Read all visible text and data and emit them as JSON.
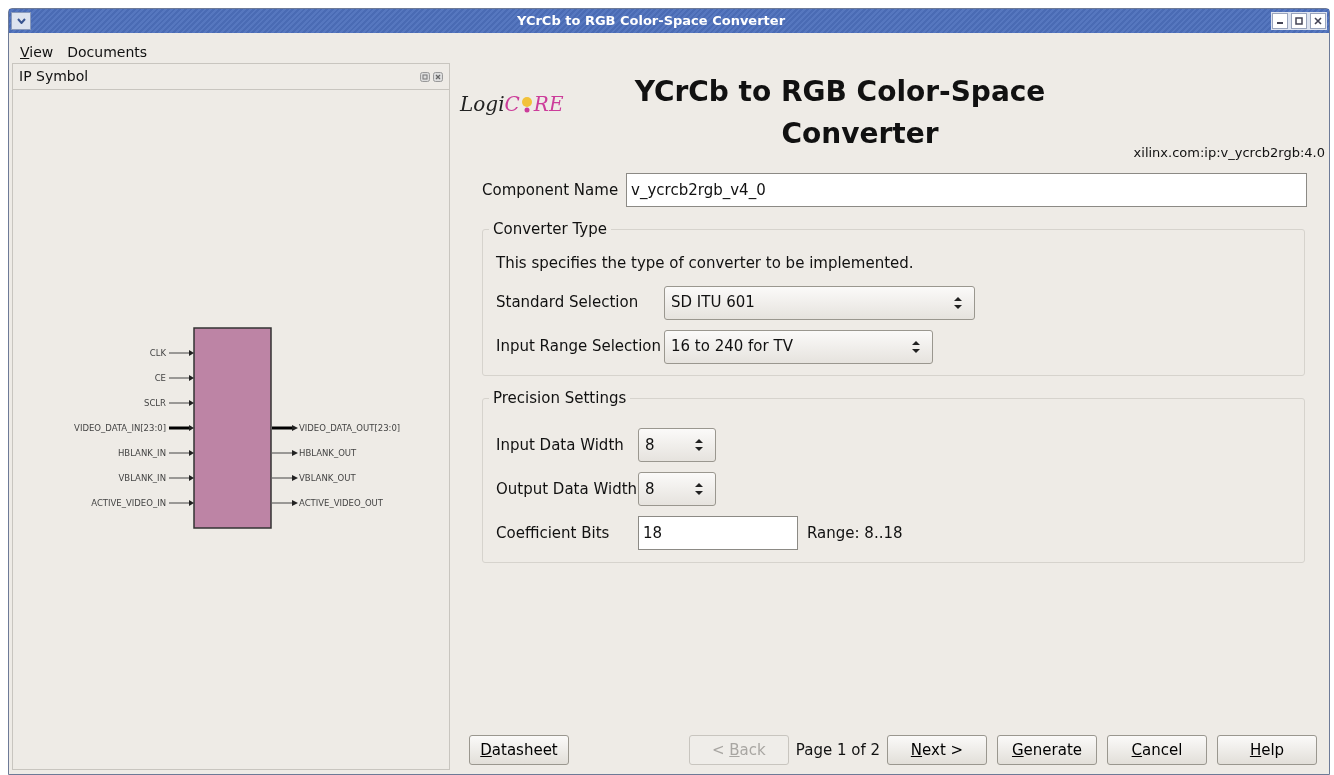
{
  "window": {
    "title": "YCrCb to RGB Color-Space Converter"
  },
  "menu": [
    {
      "key": "V",
      "after": "iew"
    },
    {
      "after": "Documents"
    }
  ],
  "ip_symbol": {
    "title": "IP Symbol",
    "inputs": [
      {
        "name": "CLK",
        "bus": false
      },
      {
        "name": "CE",
        "bus": false
      },
      {
        "name": "SCLR",
        "bus": false
      },
      {
        "name": "VIDEO_DATA_IN[23:0]",
        "bus": true
      },
      {
        "name": "HBLANK_IN",
        "bus": false
      },
      {
        "name": "VBLANK_IN",
        "bus": false
      },
      {
        "name": "ACTIVE_VIDEO_IN",
        "bus": false
      }
    ],
    "outputs": [
      {
        "name": "VIDEO_DATA_OUT[23:0]",
        "bus": true
      },
      {
        "name": "HBLANK_OUT",
        "bus": false
      },
      {
        "name": "VBLANK_OUT",
        "bus": false
      },
      {
        "name": "ACTIVE_VIDEO_OUT",
        "bus": false
      }
    ]
  },
  "logo": {
    "prefix": "Logi",
    "first": "C",
    "rest": "RE"
  },
  "heading": {
    "line1": "YCrCb to RGB Color-Space",
    "line2": "Converter",
    "vlnv": "xilinx.com:ip:v_ycrcb2rgb:4.0"
  },
  "component_name": {
    "label": "Component Name",
    "value": "v_ycrcb2rgb_v4_0"
  },
  "converter_type": {
    "title": "Converter Type",
    "description": "This specifies the type of converter to be implemented.",
    "fields": [
      {
        "kind": "select",
        "label": "Standard Selection",
        "value": "SD ITU 601"
      },
      {
        "kind": "select",
        "label": "Input Range Selection",
        "value": "16 to 240 for TV"
      }
    ]
  },
  "precision": {
    "title": "Precision Settings",
    "fields": [
      {
        "kind": "spin",
        "label": "Input Data Width",
        "value": "8"
      },
      {
        "kind": "spin",
        "label": "Output Data Width",
        "value": "8"
      },
      {
        "kind": "text",
        "label": "Coefficient Bits",
        "value": "18",
        "note": "Range: 8..18"
      }
    ]
  },
  "footer": {
    "datasheet": {
      "key": "D",
      "after": "atasheet",
      "disabled": false
    },
    "back": {
      "before": "< ",
      "key": "B",
      "after": "ack",
      "disabled": true
    },
    "page": "Page 1 of 2",
    "buttons": [
      {
        "key": "N",
        "after": "ext >",
        "disabled": false
      },
      {
        "key": "G",
        "after": "enerate",
        "disabled": false
      },
      {
        "key": "C",
        "after": "ancel",
        "disabled": false
      },
      {
        "key": "H",
        "after": "elp",
        "disabled": false
      }
    ]
  }
}
